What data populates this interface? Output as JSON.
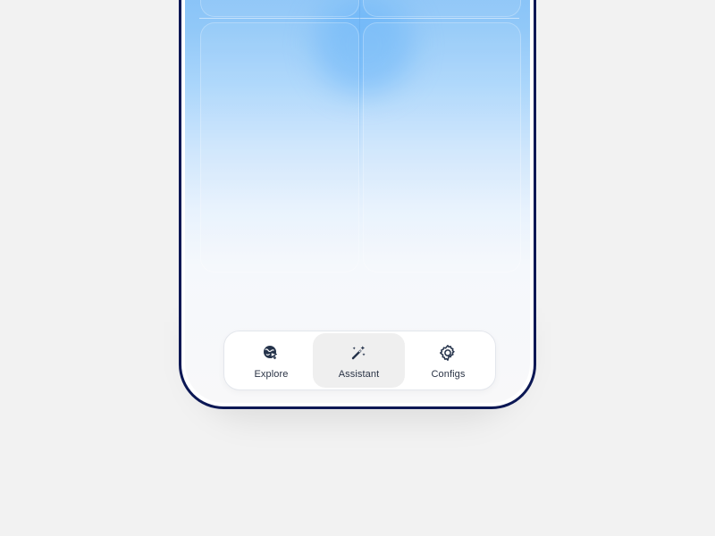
{
  "tabs": [
    {
      "label": "Explore",
      "icon": "explore-globe-cursor-icon",
      "active": false
    },
    {
      "label": "Assistant",
      "icon": "magic-wand-icon",
      "active": true
    },
    {
      "label": "Configs",
      "icon": "gear-icon",
      "active": false
    }
  ],
  "colors": {
    "background": "#f2f2f2",
    "phone_border": "#0b1754",
    "accent_blue": "#7bbcf6",
    "active_tab": "#efefef",
    "label_text": "#2a3345",
    "icon_dark": "#24324a"
  }
}
